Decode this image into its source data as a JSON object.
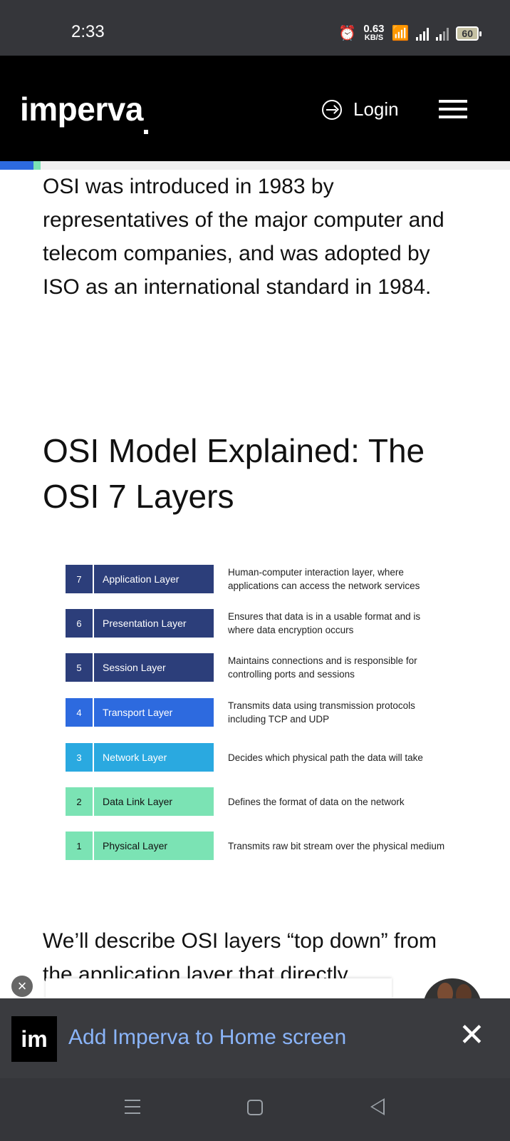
{
  "status": {
    "time": "2:33",
    "net_speed_value": "0.63",
    "net_speed_unit": "KB/S",
    "battery": "60"
  },
  "header": {
    "logo": "imperva",
    "login_label": "Login"
  },
  "reading_progress": 0.08,
  "article": {
    "intro": "OSI was introduced in 1983 by representatives of the major computer and telecom companies, and was adopted by ISO as an international standard in 1984.",
    "heading": "OSI Model Explained: The OSI 7 Layers",
    "layers": [
      {
        "num": "7",
        "name": "Application Layer",
        "desc": "Human-computer interaction layer, where applications can access the network services",
        "bg": "#2c3e7a",
        "fg": "#ffffff"
      },
      {
        "num": "6",
        "name": "Presentation Layer",
        "desc": "Ensures that data is in a usable format and is where data encryption occurs",
        "bg": "#2c3e7a",
        "fg": "#ffffff"
      },
      {
        "num": "5",
        "name": "Session Layer",
        "desc": "Maintains connections and is responsible for controlling ports and sessions",
        "bg": "#2c3e7a",
        "fg": "#ffffff"
      },
      {
        "num": "4",
        "name": "Transport Layer",
        "desc": "Transmits data using transmission protocols including TCP and UDP",
        "bg": "#2d6adf",
        "fg": "#ffffff"
      },
      {
        "num": "3",
        "name": "Network Layer",
        "desc": "Decides which physical path the data will take",
        "bg": "#2aa9e0",
        "fg": "#ffffff"
      },
      {
        "num": "2",
        "name": "Data Link Layer",
        "desc": "Defines the format of data on the network",
        "bg": "#7be3b4",
        "fg": "#111111"
      },
      {
        "num": "1",
        "name": "Physical Layer",
        "desc": "Transmits raw bit stream over the physical medium",
        "bg": "#7be3b4",
        "fg": "#111111"
      }
    ],
    "tail": "We’ll describe OSI layers “top down” from the application layer that directly"
  },
  "a2hs": {
    "icon_text": "im",
    "label": "Add Imperva to Home screen",
    "close": "✕"
  },
  "ad": {
    "close": "×"
  }
}
